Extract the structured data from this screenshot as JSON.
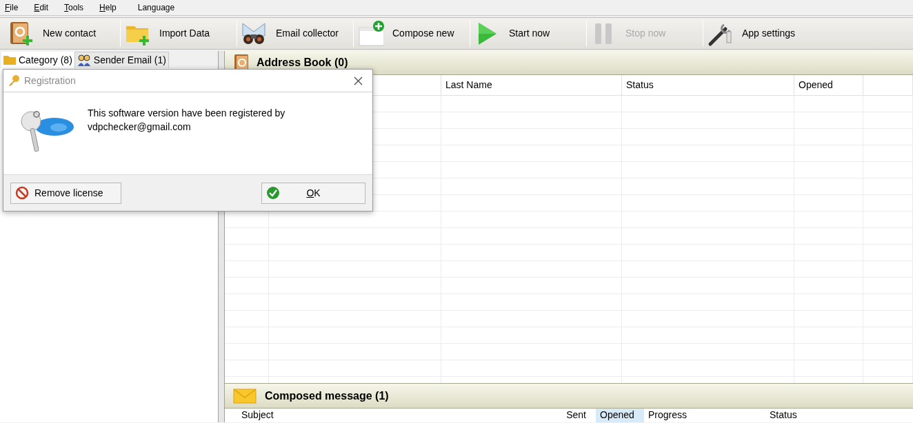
{
  "menu": [
    {
      "label": "File",
      "mnemonic": true
    },
    {
      "label": "Edit",
      "mnemonic": true
    },
    {
      "label": "Tools",
      "mnemonic": true
    },
    {
      "label": "Help",
      "mnemonic": true
    },
    {
      "label": "Language",
      "mnemonic": false
    }
  ],
  "toolbar": [
    {
      "kind": "contact",
      "label": "New contact",
      "disabled": false
    },
    {
      "kind": "import",
      "label": "Import Data",
      "disabled": false
    },
    {
      "kind": "collector",
      "label": "Email collector",
      "disabled": false
    },
    {
      "kind": "compose",
      "label": "Compose new",
      "disabled": false
    },
    {
      "kind": "start",
      "label": "Start now",
      "disabled": false
    },
    {
      "kind": "stop",
      "label": "Stop now",
      "disabled": true
    },
    {
      "kind": "settings",
      "label": "App settings",
      "disabled": false
    }
  ],
  "left_tabs": [
    {
      "kind": "folder",
      "label": "Category (8)",
      "selected": true
    },
    {
      "kind": "people",
      "label": "Sender Email (1)",
      "selected": false
    }
  ],
  "address_book": {
    "title": "Address Book (0)",
    "columns": [
      "",
      "",
      "Last Name",
      "Status",
      "Opened",
      ""
    ]
  },
  "composed": {
    "title": "Composed message (1)",
    "columns": [
      {
        "label": "Subject",
        "highlighted": false
      },
      {
        "label": "Sent",
        "highlighted": false
      },
      {
        "label": "Opened",
        "highlighted": true
      },
      {
        "label": "Progress",
        "highlighted": false
      },
      {
        "label": "Status",
        "highlighted": false
      }
    ]
  },
  "dialog": {
    "title": "Registration",
    "message_lines": [
      "This software version have been registered by",
      "vdpchecker@gmail.com"
    ],
    "buttons": [
      {
        "kind": "remove",
        "label": "Remove license",
        "mnemonic": false
      },
      {
        "kind": "ok",
        "label": "OK",
        "mnemonic": true
      }
    ]
  }
}
